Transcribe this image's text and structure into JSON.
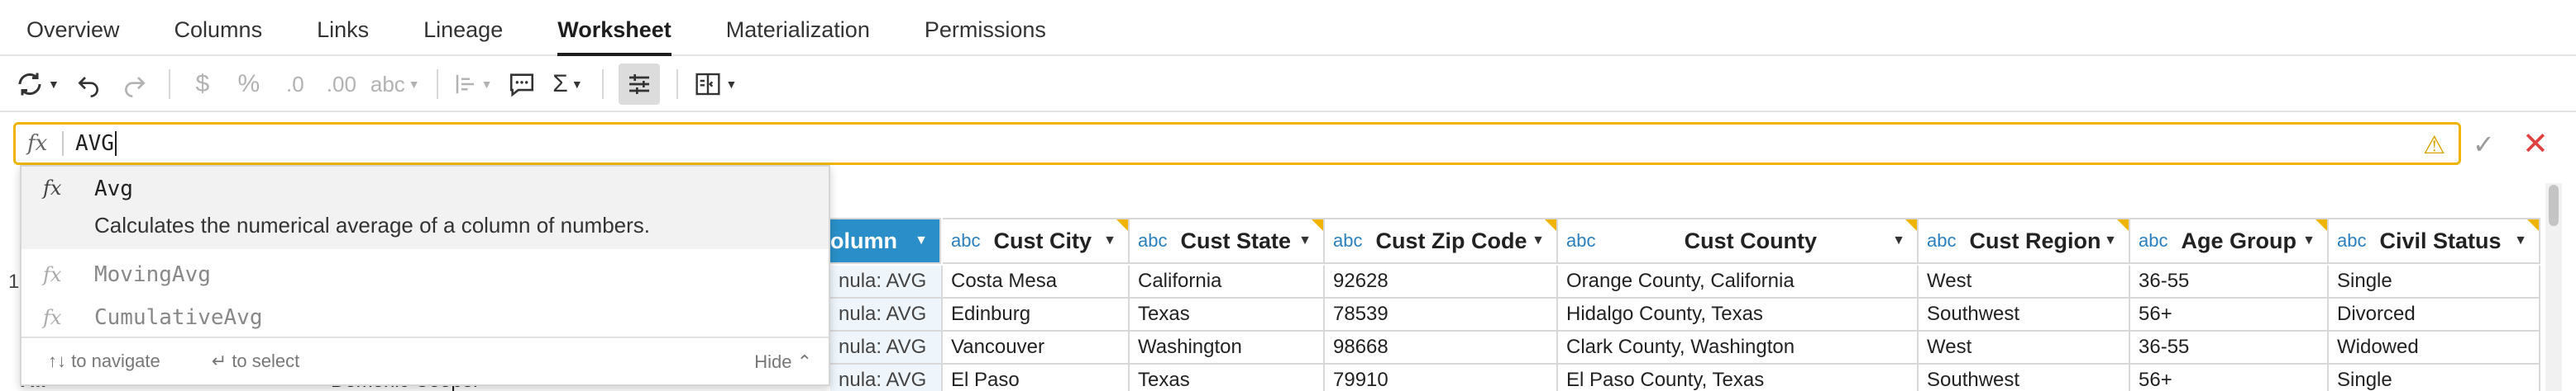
{
  "tabs": [
    {
      "label": "Overview"
    },
    {
      "label": "Columns"
    },
    {
      "label": "Links"
    },
    {
      "label": "Lineage"
    },
    {
      "label": "Worksheet"
    },
    {
      "label": "Materialization"
    },
    {
      "label": "Permissions"
    }
  ],
  "active_tab": "Worksheet",
  "toolbar": {
    "format_abc": "abc"
  },
  "formula": {
    "fx": "fx",
    "value": "AVG"
  },
  "autocomplete": {
    "primary": {
      "name": "Avg",
      "description": "Calculates the numerical average of a column of numbers."
    },
    "others": [
      {
        "name": "MovingAvg"
      },
      {
        "name": "CumulativeAvg"
      }
    ],
    "footer": {
      "navigate": "to navigate",
      "select": "to select",
      "hide": "Hide"
    }
  },
  "grid": {
    "left_header_partial": "olumn",
    "columns": [
      {
        "type": "abc",
        "name": "Cust City"
      },
      {
        "type": "abc",
        "name": "Cust State"
      },
      {
        "type": "abc",
        "name": "Cust Zip Code"
      },
      {
        "type": "abc",
        "name": "Cust County"
      },
      {
        "type": "abc",
        "name": "Cust Region"
      },
      {
        "type": "abc",
        "name": "Age Group"
      },
      {
        "type": "abc",
        "name": "Civil Status"
      }
    ],
    "rows": [
      {
        "formula_cell": "nula: AVG",
        "cells": [
          "Costa Mesa",
          "California",
          "92628",
          "Orange County, California",
          "West",
          "36-55",
          "Single"
        ]
      },
      {
        "formula_cell": "nula: AVG",
        "cells": [
          "Edinburg",
          "Texas",
          "78539",
          "Hidalgo County, Texas",
          "Southwest",
          "56+",
          "Divorced"
        ]
      },
      {
        "formula_cell": "nula: AVG",
        "cells": [
          "Vancouver",
          "Washington",
          "98668",
          "Clark County, Washington",
          "West",
          "36-55",
          "Widowed"
        ]
      },
      {
        "formula_cell": "nula: AVG",
        "cells": [
          "El Paso",
          "Texas",
          "79910",
          "El Paso County, Texas",
          "Southwest",
          "56+",
          "Single"
        ]
      }
    ],
    "left_partial": {
      "row0_prefix": "1",
      "row3_text": "Domenic Cooper",
      "row3_prefix": "F..."
    }
  }
}
